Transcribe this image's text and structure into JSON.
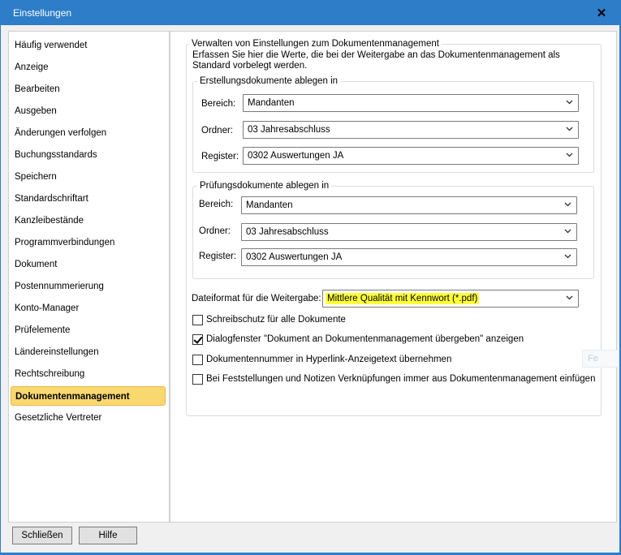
{
  "window": {
    "title": "Einstellungen",
    "close_symbol": "✕"
  },
  "sidebar": {
    "items": [
      {
        "label": "Häufig verwendet",
        "active": false
      },
      {
        "label": "Anzeige",
        "active": false
      },
      {
        "label": "Bearbeiten",
        "active": false
      },
      {
        "label": "Ausgeben",
        "active": false
      },
      {
        "label": "Änderungen verfolgen",
        "active": false
      },
      {
        "label": "Buchungsstandards",
        "active": false
      },
      {
        "label": "Speichern",
        "active": false
      },
      {
        "label": "Standardschriftart",
        "active": false
      },
      {
        "label": "Kanzleibestände",
        "active": false
      },
      {
        "label": "Programmverbindungen",
        "active": false
      },
      {
        "label": "Dokument",
        "active": false
      },
      {
        "label": "Postennummerierung",
        "active": false
      },
      {
        "label": "Konto-Manager",
        "active": false
      },
      {
        "label": "Prüfelemente",
        "active": false
      },
      {
        "label": "Ländereinstellungen",
        "active": false
      },
      {
        "label": "Rechtschreibung",
        "active": false
      },
      {
        "label": "Dokumentenmanagement",
        "active": true
      },
      {
        "label": "Gesetzliche Vertreter",
        "active": false
      }
    ]
  },
  "main": {
    "group_title": "Verwalten von Einstellungen zum Dokumentenmanagement",
    "intro": "Erfassen Sie hier die Werte, die bei der Weitergabe an das Dokumentenmanagement als Standard vorbelegt werden.",
    "erstellung": {
      "title": "Erstellungsdokumente ablegen in",
      "bereich_label": "Bereich:",
      "bereich_value": "Mandanten",
      "ordner_label": "Ordner:",
      "ordner_value": "03 Jahresabschluss",
      "register_label": "Register:",
      "register_value": "0302 Auswertungen JA"
    },
    "pruefung": {
      "title": "Prüfungsdokumente ablegen in",
      "bereich_label": "Bereich:",
      "bereich_value": "Mandanten",
      "ordner_label": "Ordner:",
      "ordner_value": "03 Jahresabschluss",
      "register_label": "Register:",
      "register_value": "0302 Auswertungen JA"
    },
    "dateiformat_label": "Dateiformat für die Weitergabe:",
    "dateiformat_value": "Mittlere Qualität mit Kennwort (*.pdf)",
    "highlight_color": "#ffff3c",
    "checkboxes": [
      {
        "label": "Schreibschutz für alle Dokumente",
        "checked": false
      },
      {
        "label": "Dialogfenster \"Dokument an Dokumentenmanagement übergeben\" anzeigen",
        "checked": true
      },
      {
        "label": "Dokumentennummer in Hyperlink-Anzeigetext übernehmen",
        "checked": false
      },
      {
        "label": "Bei Feststellungen und Notizen Verknüpfungen immer aus Dokumentenmanagement einfügen",
        "checked": false
      }
    ],
    "ghost_text": "Fe"
  },
  "footer": {
    "close_label": "Schließen",
    "help_label": "Hilfe"
  },
  "colors": {
    "titlebar": "#2d7dc8",
    "active_item": "#fad870"
  }
}
